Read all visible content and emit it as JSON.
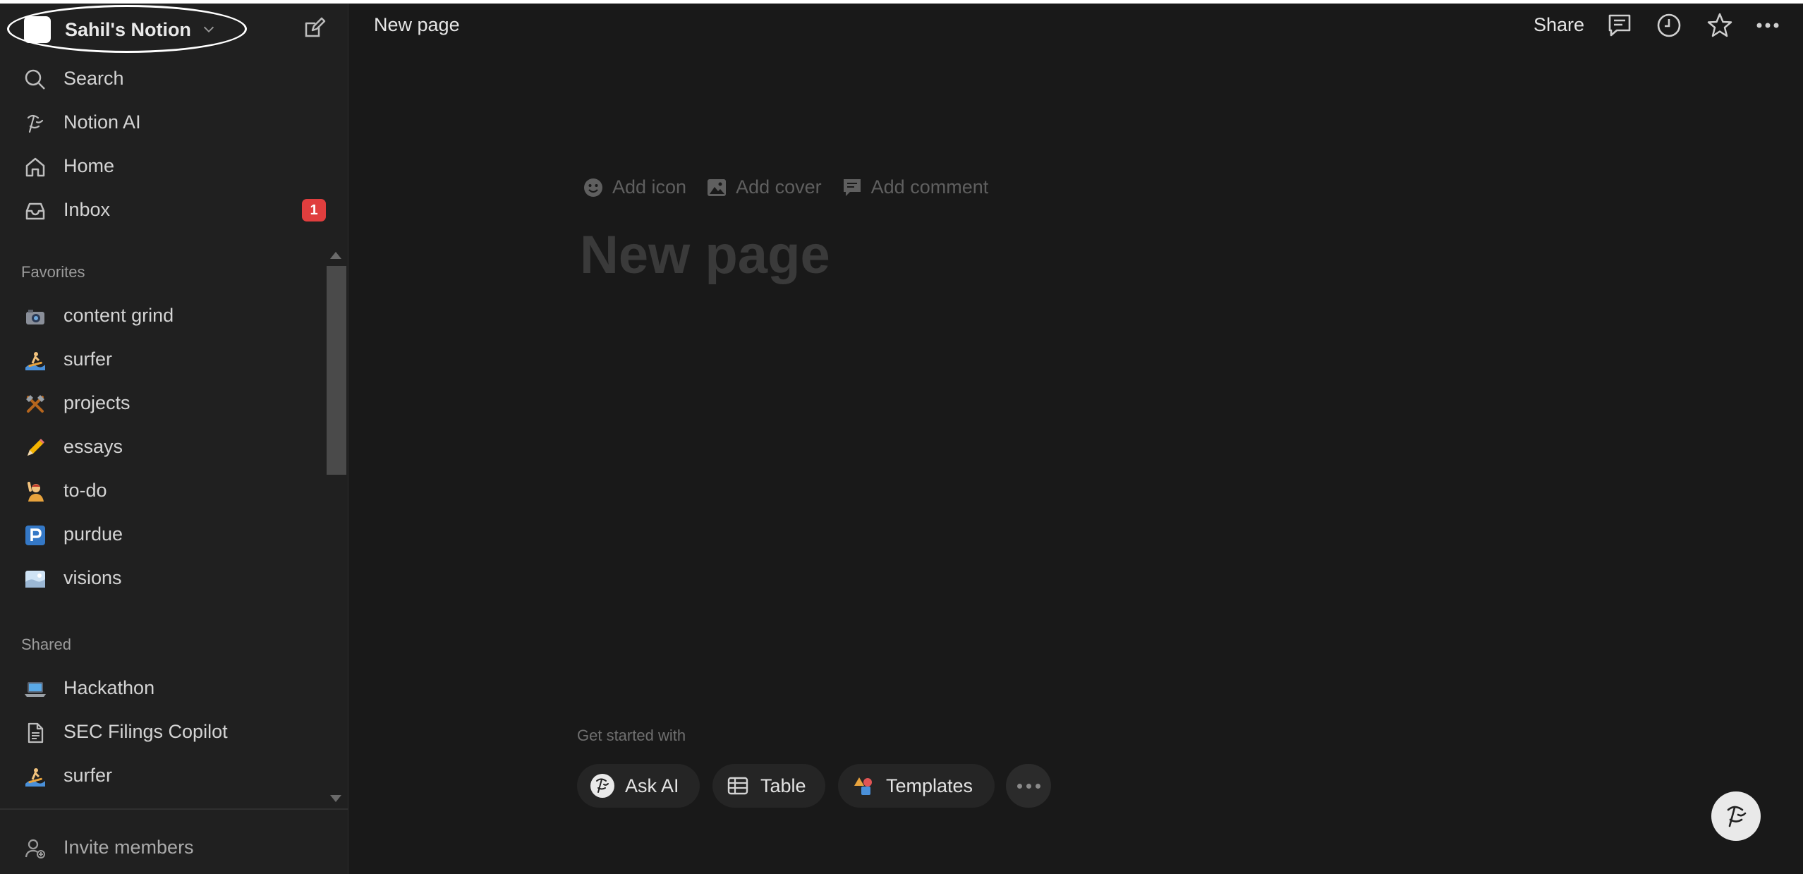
{
  "workspace": {
    "name": "Sahil's Notion"
  },
  "nav": [
    {
      "label": "Search",
      "icon": "search-icon"
    },
    {
      "label": "Notion AI",
      "icon": "notion-ai-icon"
    },
    {
      "label": "Home",
      "icon": "home-icon"
    },
    {
      "label": "Inbox",
      "icon": "inbox-icon",
      "badge": "1"
    }
  ],
  "favorites": {
    "header": "Favorites",
    "items": [
      {
        "label": "content grind",
        "icon": "camera-icon"
      },
      {
        "label": "surfer",
        "icon": "surfer-icon"
      },
      {
        "label": "projects",
        "icon": "hammer-pick-icon"
      },
      {
        "label": "essays",
        "icon": "pencil-icon"
      },
      {
        "label": "to-do",
        "icon": "person-raising-hand-icon"
      },
      {
        "label": "purdue",
        "icon": "p-button-icon"
      },
      {
        "label": "visions",
        "icon": "sunrise-icon"
      }
    ]
  },
  "shared": {
    "header": "Shared",
    "items": [
      {
        "label": "Hackathon",
        "icon": "laptop-icon"
      },
      {
        "label": "SEC Filings Copilot",
        "icon": "document-icon"
      },
      {
        "label": "surfer",
        "icon": "surfer-icon"
      }
    ]
  },
  "footer": {
    "invite": "Invite members"
  },
  "topbar": {
    "title": "New page",
    "share": "Share"
  },
  "page": {
    "actions": {
      "add_icon": "Add icon",
      "add_cover": "Add cover",
      "add_comment": "Add comment"
    },
    "title_placeholder": "New page",
    "get_started": "Get started with",
    "quick": {
      "ask_ai": "Ask AI",
      "table": "Table",
      "templates": "Templates"
    }
  },
  "colors": {
    "background": "#191919",
    "sidebar": "#202020",
    "badge": "#e03e3e"
  }
}
